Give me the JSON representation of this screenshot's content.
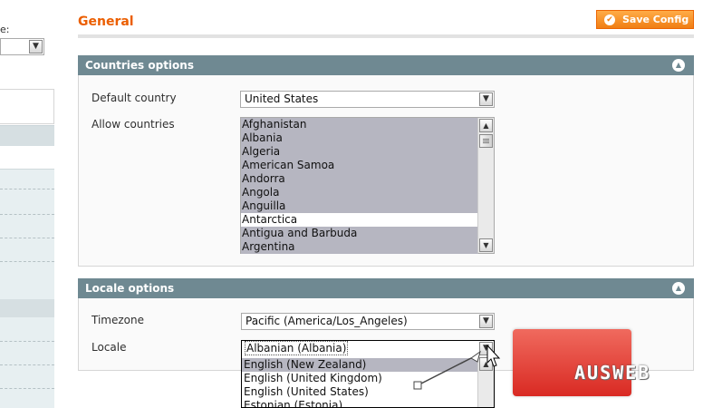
{
  "sidebar": {
    "scope_label": "e:",
    "scope_select_value": ""
  },
  "header": {
    "title": "General",
    "save_button_label": "Save Config"
  },
  "countries_section": {
    "title": "Countries options",
    "default_country_label": "Default country",
    "default_country_value": "United States",
    "allow_countries_label": "Allow countries",
    "allow_countries_options": [
      "Afghanistan",
      "Albania",
      "Algeria",
      "American Samoa",
      "Andorra",
      "Angola",
      "Anguilla",
      "Antarctica",
      "Antigua and Barbuda",
      "Argentina"
    ],
    "allow_countries_unselected_option": "Antarctica"
  },
  "locale_section": {
    "title": "Locale options",
    "timezone_label": "Timezone",
    "timezone_value": "Pacific (America/Los_Angeles)",
    "locale_label": "Locale",
    "locale_value": "Albanian (Albania)",
    "locale_dropdown_options": [
      "English (New Zealand)",
      "English (United Kingdom)",
      "English (United States)",
      "Estonian (Estonia)"
    ],
    "locale_highlighted_option": "English (New Zealand)"
  },
  "colors": {
    "accent_orange": "#eb5e00",
    "section_header": "#6f8992",
    "selected_option": "#b6b6c1"
  },
  "watermark": {
    "text": "AUSWEB"
  }
}
